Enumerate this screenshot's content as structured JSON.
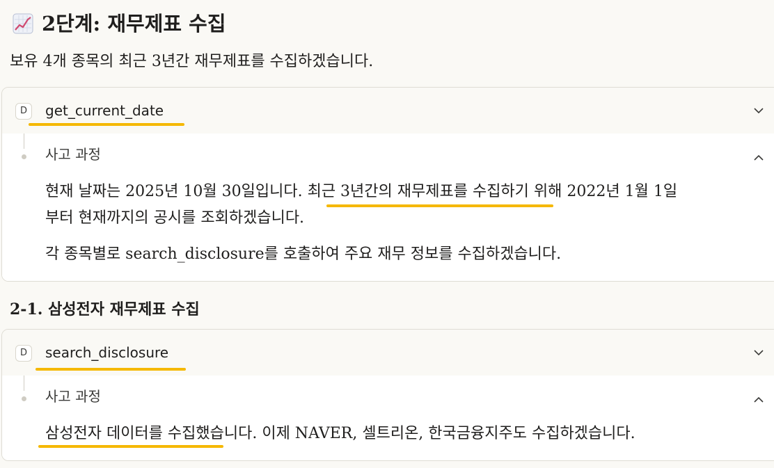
{
  "heading": {
    "icon": "chart-increasing-icon",
    "title": "2단계: 재무제표 수집"
  },
  "intro": "보유 4개 종목의 최근 3년간 재무제표를 수집하겠습니다.",
  "card1": {
    "badge": "D",
    "tool_name": "get_current_date",
    "thinking_label": "사고 과정",
    "para1_line1": "현재 날짜는 2025년 10월 30일입니다. 최근 3년간의 재무제표를 수집하기 위해 2022년 1월 1일",
    "para1_line2": "부터 현재까지의 공시를 조회하겠습니다.",
    "para2": "각 종목별로 search_disclosure를 호출하여 주요 재무 정보를 수집하겠습니다."
  },
  "subheading": "2-1. 삼성전자 재무제표 수집",
  "card2": {
    "badge": "D",
    "tool_name": "search_disclosure",
    "thinking_label": "사고 과정",
    "para1": "삼성전자 데이터를 수집했습니다. 이제 NAVER, 셀트리온, 한국금융지주도 수집하겠습니다."
  },
  "colors": {
    "highlight": "#f5b800",
    "background": "#faf9f5",
    "card_border": "#dedcd4"
  }
}
